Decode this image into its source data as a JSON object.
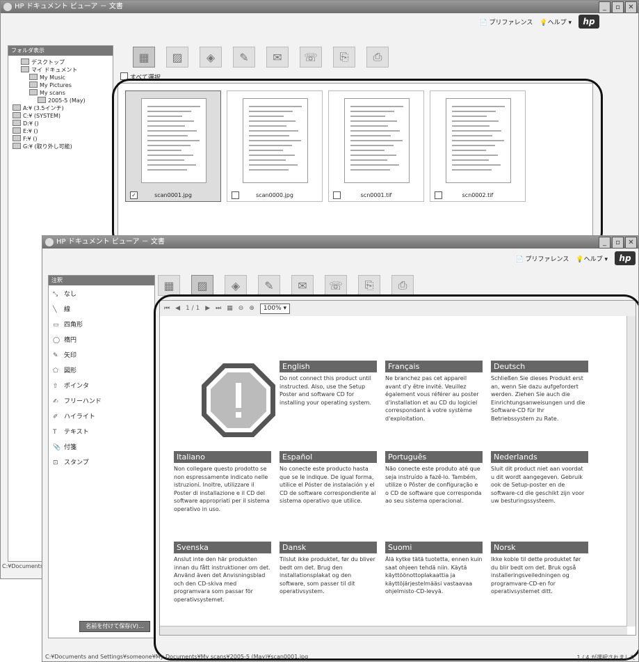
{
  "window1": {
    "title": "HP ドキュメント ビューア － 文書",
    "help": {
      "preferences": "プリファレンス",
      "help": "ヘルプ",
      "hp": "hp"
    },
    "folder_pane_title": "フォルダ表示",
    "tree": [
      "デスクトップ",
      "マイ ドキュメント",
      "My Music",
      "My Pictures",
      "My scans",
      "2005-5 (May)",
      "A:¥ (3.5インチ)",
      "C:¥ (SYSTEM)",
      "D:¥ ()",
      "E:¥ ()",
      "F:¥ ()",
      "G:¥ (取り外し可能)"
    ],
    "select_all": "すべて選択",
    "thumbs": [
      {
        "name": "scan0001.jpg",
        "checked": true
      },
      {
        "name": "scan0000.jpg",
        "checked": false
      },
      {
        "name": "scn0001.tif",
        "checked": false
      },
      {
        "name": "scn0002.tif",
        "checked": false
      }
    ],
    "left_status": "C:¥Documents"
  },
  "window2": {
    "title": "HP ドキュメント ビューア － 文書",
    "help": {
      "preferences": "プリファレンス",
      "help": "ヘルプ",
      "hp": "hp"
    },
    "annot_title": "注釈",
    "annotations": [
      {
        "icon": "⤡",
        "label": "なし"
      },
      {
        "icon": "╲",
        "label": "線"
      },
      {
        "icon": "▭",
        "label": "四角形"
      },
      {
        "icon": "◯",
        "label": "楕円"
      },
      {
        "icon": "✎",
        "label": "矢印"
      },
      {
        "icon": "⬠",
        "label": "図形"
      },
      {
        "icon": "⇧",
        "label": "ポインタ"
      },
      {
        "icon": "✍",
        "label": "フリーハンド"
      },
      {
        "icon": "✐",
        "label": "ハイライト"
      },
      {
        "icon": "T",
        "label": "テキスト"
      },
      {
        "icon": "📎",
        "label": "付箋"
      },
      {
        "icon": "⊡",
        "label": "スタンプ"
      }
    ],
    "save_as": "名前を付けて保存(V)...",
    "page_indicator": "1 / 1",
    "zoom": "100%",
    "status_path": "C:¥Documents and Settings¥someone¥My Documents¥My scans¥2005-5 (May)¥scan0001.jpg",
    "status_right": "1 / 4 が選択されました"
  },
  "languages": [
    {
      "name": "English",
      "text": "Do not connect this product until instructed. Also, use the Setup Poster and software CD for installing your operating system."
    },
    {
      "name": "Français",
      "text": "Ne branchez pas cet appareil avant d'y être invité. Veuillez également vous référer au poster d'installation et au CD du logiciel correspondant à votre système d'exploitation."
    },
    {
      "name": "Deutsch",
      "text": "Schließen Sie dieses Produkt erst an, wenn Sie dazu aufgefordert werden. Ziehen Sie auch die Einrichtungsanweisungen und die Software-CD für Ihr Betriebssystem zu Rate."
    },
    {
      "name": "Italiano",
      "text": "Non collegare questo prodotto se non espressamente indicato nelle istruzioni. Inoltre, utilizzare il Poster di installazione e il CD del software appropriati per il sistema operativo in uso."
    },
    {
      "name": "Español",
      "text": "No conecte este producto hasta que se le indique. De igual forma, utilice el Póster de instalación y el CD de software correspondiente al sistema operativo que utilice."
    },
    {
      "name": "Português",
      "text": "Não conecte este produto até que seja instruído a fazê-lo. Também, utilize o Pôster de configuração e o CD de software que corresponda ao seu sistema operacional."
    },
    {
      "name": "Nederlands",
      "text": "Sluit dit product niet aan voordat u dit wordt aangegeven. Gebruik ook de Setup-poster en de software-cd die geschikt zijn voor uw besturingssysteem."
    },
    {
      "name": "Svenska",
      "text": "Anslut inte den här produkten innan du fått instruktioner om det. Använd även det Anvisningsblad och den CD-skiva med programvara som passar för operativsystemet."
    },
    {
      "name": "Dansk",
      "text": "Tilslut ikke produktet, før du bliver bedt om det. Brug den installationsplakat og den software, som passer til dit operativsystem."
    },
    {
      "name": "Suomi",
      "text": "Älä kytke tätä tuotetta, ennen kuin saat ohjeen tehdä niin. Käytä käyttöönottoplakaattia ja käyttöjärjestelmääsi vastaavaa ohjelmisto-CD-levyä."
    },
    {
      "name": "Norsk",
      "text": "Ikke koble til dette produktet før du blir bedt om det. Bruk også installeringsveiledningen og programvare-CD-en for operativsystemet ditt."
    }
  ]
}
